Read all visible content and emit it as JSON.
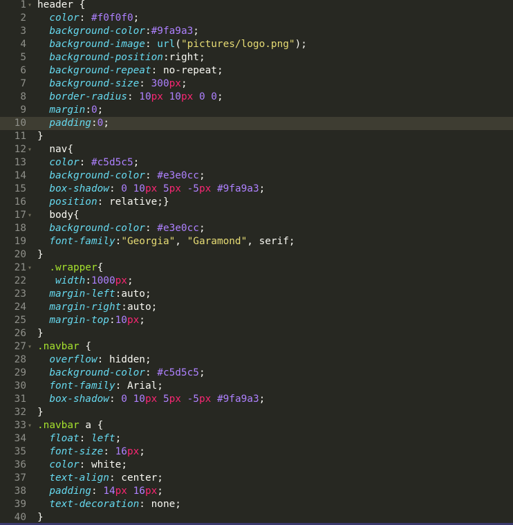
{
  "editor": {
    "active_line": 10,
    "lines": [
      {
        "n": "1",
        "fold": true,
        "tokens": [
          [
            "sel",
            "header {"
          ]
        ]
      },
      {
        "n": "2",
        "tokens": [
          [
            "prop",
            "color"
          ],
          [
            "punc",
            ": "
          ],
          [
            "num-v",
            "#f0f0f0"
          ],
          [
            "punc",
            ";"
          ]
        ]
      },
      {
        "n": "3",
        "tokens": [
          [
            "prop",
            "background-color"
          ],
          [
            "punc",
            ":"
          ],
          [
            "num-v",
            "#9fa9a3"
          ],
          [
            "punc",
            ";"
          ]
        ]
      },
      {
        "n": "4",
        "tokens": [
          [
            "prop",
            "background-image"
          ],
          [
            "punc",
            ": "
          ],
          [
            "fn",
            "url"
          ],
          [
            "punc",
            "("
          ],
          [
            "str",
            "\"pictures/logo.png\""
          ],
          [
            "punc",
            ");"
          ]
        ]
      },
      {
        "n": "5",
        "tokens": [
          [
            "prop",
            "background-position"
          ],
          [
            "punc",
            ":"
          ],
          [
            "val",
            "right"
          ],
          [
            "punc",
            ";"
          ]
        ]
      },
      {
        "n": "6",
        "tokens": [
          [
            "prop",
            "background-repeat"
          ],
          [
            "punc",
            ": "
          ],
          [
            "val",
            "no-repeat"
          ],
          [
            "punc",
            ";"
          ]
        ]
      },
      {
        "n": "7",
        "tokens": [
          [
            "prop",
            "background-size"
          ],
          [
            "punc",
            ": "
          ],
          [
            "num-v",
            "300"
          ],
          [
            "unit",
            "px"
          ],
          [
            "punc",
            ";"
          ]
        ]
      },
      {
        "n": "8",
        "tokens": [
          [
            "prop",
            "border-radius"
          ],
          [
            "punc",
            ": "
          ],
          [
            "num-v",
            "10"
          ],
          [
            "unit",
            "px"
          ],
          [
            "punc",
            " "
          ],
          [
            "num-v",
            "10"
          ],
          [
            "unit",
            "px"
          ],
          [
            "punc",
            " "
          ],
          [
            "num-v",
            "0"
          ],
          [
            "punc",
            " "
          ],
          [
            "num-v",
            "0"
          ],
          [
            "punc",
            ";"
          ]
        ]
      },
      {
        "n": "9",
        "tokens": [
          [
            "prop",
            "margin"
          ],
          [
            "punc",
            ":"
          ],
          [
            "num-v",
            "0"
          ],
          [
            "punc",
            ";"
          ]
        ]
      },
      {
        "n": "10",
        "tokens": [
          [
            "prop",
            "padding"
          ],
          [
            "punc",
            ":"
          ],
          [
            "num-v",
            "0"
          ],
          [
            "punc",
            ";"
          ]
        ]
      },
      {
        "n": "11",
        "tokens": [
          [
            "punc",
            "}"
          ]
        ]
      },
      {
        "n": "12",
        "fold": true,
        "tokens": [
          [
            "sel",
            "  nav{"
          ]
        ]
      },
      {
        "n": "13",
        "tokens": [
          [
            "prop",
            "color"
          ],
          [
            "punc",
            ": "
          ],
          [
            "num-v",
            "#c5d5c5"
          ],
          [
            "punc",
            ";"
          ]
        ]
      },
      {
        "n": "14",
        "tokens": [
          [
            "prop",
            "background-color"
          ],
          [
            "punc",
            ": "
          ],
          [
            "num-v",
            "#e3e0cc"
          ],
          [
            "punc",
            ";"
          ]
        ]
      },
      {
        "n": "15",
        "tokens": [
          [
            "prop",
            "box-shadow"
          ],
          [
            "punc",
            ": "
          ],
          [
            "num-v",
            "0"
          ],
          [
            "punc",
            " "
          ],
          [
            "num-v",
            "10"
          ],
          [
            "unit",
            "px"
          ],
          [
            "punc",
            " "
          ],
          [
            "num-v",
            "5"
          ],
          [
            "unit",
            "px"
          ],
          [
            "punc",
            " "
          ],
          [
            "num-v",
            "-5"
          ],
          [
            "unit",
            "px"
          ],
          [
            "punc",
            " "
          ],
          [
            "num-v",
            "#9fa9a3"
          ],
          [
            "punc",
            ";"
          ]
        ]
      },
      {
        "n": "16",
        "tokens": [
          [
            "prop",
            "position"
          ],
          [
            "punc",
            ": "
          ],
          [
            "val",
            "relative"
          ],
          [
            "punc",
            ";}"
          ]
        ]
      },
      {
        "n": "17",
        "fold": true,
        "tokens": [
          [
            "sel",
            "  body{"
          ]
        ]
      },
      {
        "n": "18",
        "tokens": [
          [
            "prop",
            "background-color"
          ],
          [
            "punc",
            ": "
          ],
          [
            "num-v",
            "#e3e0cc"
          ],
          [
            "punc",
            ";"
          ]
        ]
      },
      {
        "n": "19",
        "tokens": [
          [
            "prop",
            "font-family"
          ],
          [
            "punc",
            ":"
          ],
          [
            "str",
            "\"Georgia\""
          ],
          [
            "punc",
            ", "
          ],
          [
            "str",
            "\"Garamond\""
          ],
          [
            "punc",
            ", "
          ],
          [
            "val",
            "serif"
          ],
          [
            "punc",
            ";"
          ]
        ]
      },
      {
        "n": "20",
        "tokens": [
          [
            "punc",
            "}"
          ]
        ]
      },
      {
        "n": "21",
        "fold": true,
        "tokens": [
          [
            "cls",
            "  .wrapper"
          ],
          [
            "punc",
            "{"
          ]
        ]
      },
      {
        "n": "22",
        "tokens": [
          [
            "prop",
            " width"
          ],
          [
            "punc",
            ":"
          ],
          [
            "num-v",
            "1000"
          ],
          [
            "unit",
            "px"
          ],
          [
            "punc",
            ";"
          ]
        ]
      },
      {
        "n": "23",
        "tokens": [
          [
            "prop",
            "margin-left"
          ],
          [
            "punc",
            ":"
          ],
          [
            "val",
            "auto"
          ],
          [
            "punc",
            ";"
          ]
        ]
      },
      {
        "n": "24",
        "tokens": [
          [
            "prop",
            "margin-right"
          ],
          [
            "punc",
            ":"
          ],
          [
            "val",
            "auto"
          ],
          [
            "punc",
            ";"
          ]
        ]
      },
      {
        "n": "25",
        "tokens": [
          [
            "prop",
            "margin-top"
          ],
          [
            "punc",
            ":"
          ],
          [
            "num-v",
            "10"
          ],
          [
            "unit",
            "px"
          ],
          [
            "punc",
            ";"
          ]
        ]
      },
      {
        "n": "26",
        "tokens": [
          [
            "punc",
            "}"
          ]
        ]
      },
      {
        "n": "27",
        "fold": true,
        "tokens": [
          [
            "cls",
            ".navbar"
          ],
          [
            "punc",
            " {"
          ]
        ]
      },
      {
        "n": "28",
        "tokens": [
          [
            "prop",
            "overflow"
          ],
          [
            "punc",
            ": "
          ],
          [
            "val",
            "hidden"
          ],
          [
            "punc",
            ";"
          ]
        ]
      },
      {
        "n": "29",
        "tokens": [
          [
            "prop",
            "background-color"
          ],
          [
            "punc",
            ": "
          ],
          [
            "num-v",
            "#c5d5c5"
          ],
          [
            "punc",
            ";"
          ]
        ]
      },
      {
        "n": "30",
        "tokens": [
          [
            "prop",
            "font-family"
          ],
          [
            "punc",
            ": "
          ],
          [
            "val",
            "Arial"
          ],
          [
            "punc",
            ";"
          ]
        ]
      },
      {
        "n": "31",
        "tokens": [
          [
            "prop",
            "box-shadow"
          ],
          [
            "punc",
            ": "
          ],
          [
            "num-v",
            "0"
          ],
          [
            "punc",
            " "
          ],
          [
            "num-v",
            "10"
          ],
          [
            "unit",
            "px"
          ],
          [
            "punc",
            " "
          ],
          [
            "num-v",
            "5"
          ],
          [
            "unit",
            "px"
          ],
          [
            "punc",
            " "
          ],
          [
            "num-v",
            "-5"
          ],
          [
            "unit",
            "px"
          ],
          [
            "punc",
            " "
          ],
          [
            "num-v",
            "#9fa9a3"
          ],
          [
            "punc",
            ";"
          ]
        ]
      },
      {
        "n": "32",
        "tokens": [
          [
            "punc",
            "}"
          ]
        ]
      },
      {
        "n": "33",
        "fold": true,
        "tokens": [
          [
            "cls",
            ".navbar"
          ],
          [
            "punc",
            " a {"
          ]
        ]
      },
      {
        "n": "34",
        "tokens": [
          [
            "prop",
            "float"
          ],
          [
            "punc",
            ": "
          ],
          [
            "prop",
            "left"
          ],
          [
            "punc",
            ";"
          ]
        ]
      },
      {
        "n": "35",
        "tokens": [
          [
            "prop",
            "font-size"
          ],
          [
            "punc",
            ": "
          ],
          [
            "num-v",
            "16"
          ],
          [
            "unit",
            "px"
          ],
          [
            "punc",
            ";"
          ]
        ]
      },
      {
        "n": "36",
        "tokens": [
          [
            "prop",
            "color"
          ],
          [
            "punc",
            ": "
          ],
          [
            "val",
            "white"
          ],
          [
            "punc",
            ";"
          ]
        ]
      },
      {
        "n": "37",
        "tokens": [
          [
            "prop",
            "text-align"
          ],
          [
            "punc",
            ": "
          ],
          [
            "val",
            "center"
          ],
          [
            "punc",
            ";"
          ]
        ]
      },
      {
        "n": "38",
        "tokens": [
          [
            "prop",
            "padding"
          ],
          [
            "punc",
            ": "
          ],
          [
            "num-v",
            "14"
          ],
          [
            "unit",
            "px"
          ],
          [
            "punc",
            " "
          ],
          [
            "num-v",
            "16"
          ],
          [
            "unit",
            "px"
          ],
          [
            "punc",
            ";"
          ]
        ]
      },
      {
        "n": "39",
        "tokens": [
          [
            "prop",
            "text-decoration"
          ],
          [
            "punc",
            ": "
          ],
          [
            "val",
            "none"
          ],
          [
            "punc",
            ";"
          ]
        ]
      },
      {
        "n": "40",
        "tokens": [
          [
            "punc",
            "}"
          ]
        ]
      }
    ]
  }
}
